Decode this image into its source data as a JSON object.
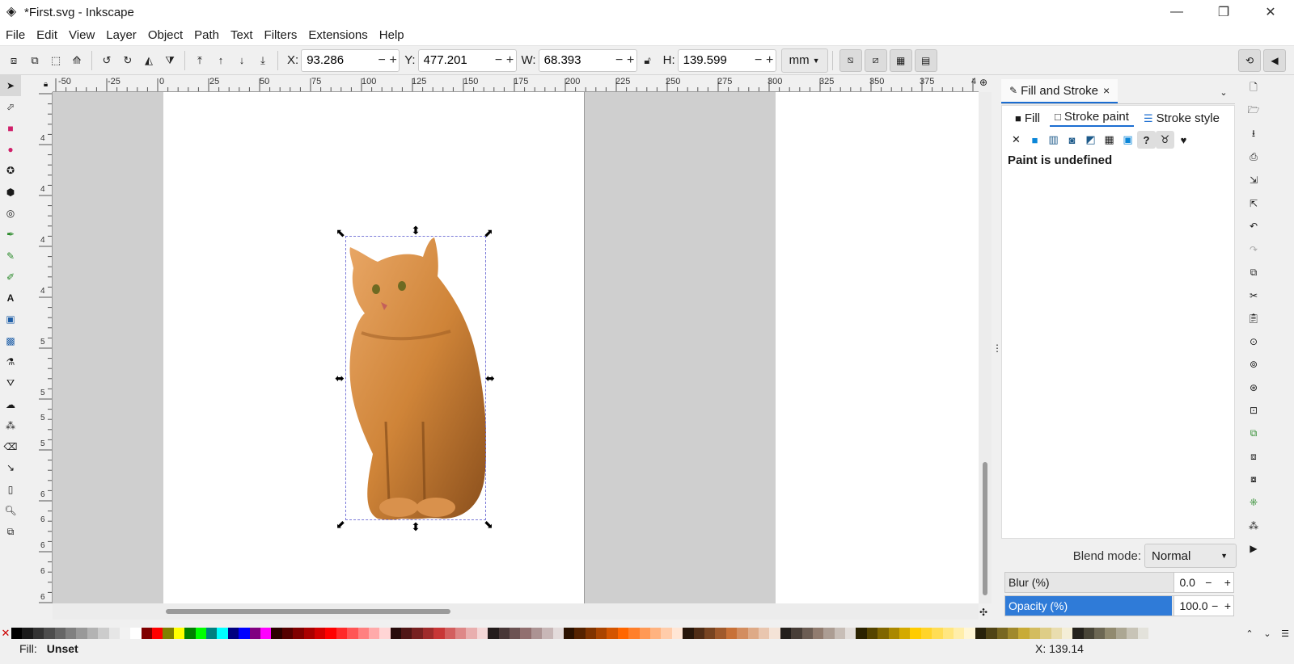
{
  "window": {
    "title": "*First.svg - Inkscape",
    "minimize": "—",
    "restore": "❐",
    "close": "✕"
  },
  "menu": [
    "File",
    "Edit",
    "View",
    "Layer",
    "Object",
    "Path",
    "Text",
    "Filters",
    "Extensions",
    "Help"
  ],
  "toolbar": {
    "x_label": "X:",
    "x_value": "93.286",
    "y_label": "Y:",
    "y_value": "477.201",
    "w_label": "W:",
    "w_value": "68.393",
    "h_label": "H:",
    "h_value": "139.599",
    "minus": "−",
    "plus": "+",
    "unit": "mm"
  },
  "rulers": {
    "h_ticks": [
      "-50",
      "-25",
      "0",
      "25",
      "50",
      "75",
      "100",
      "125",
      "150",
      "175",
      "200",
      "225",
      "250",
      "275",
      "300",
      "325",
      "350",
      "375",
      "4"
    ],
    "v_ticks": [
      "4",
      "4",
      "4",
      "4",
      "5",
      "5",
      "5",
      "5",
      "6",
      "6",
      "6",
      "6",
      "6"
    ]
  },
  "dock": {
    "tab_label": "Fill and Stroke",
    "tab_close": "×",
    "subtabs": {
      "fill": "Fill",
      "stroke_paint": "Stroke paint",
      "stroke_style": "Stroke style"
    },
    "paint_message": "Paint is undefined",
    "blend_label": "Blend mode:",
    "blend_value": "Normal",
    "blur_label": "Blur (%)",
    "blur_value": "0.0",
    "opacity_label": "Opacity (%)",
    "opacity_value": "100.0",
    "opacity_fraction": 1.0
  },
  "status": {
    "fill_label": "Fill:",
    "fill_value": "Unset",
    "cursor_x": "X: 139.14"
  },
  "colors": {
    "accent": "#2f7bd8",
    "selection_dash": "#7b7bd8",
    "canvas_bg": "#cfcfcf"
  }
}
